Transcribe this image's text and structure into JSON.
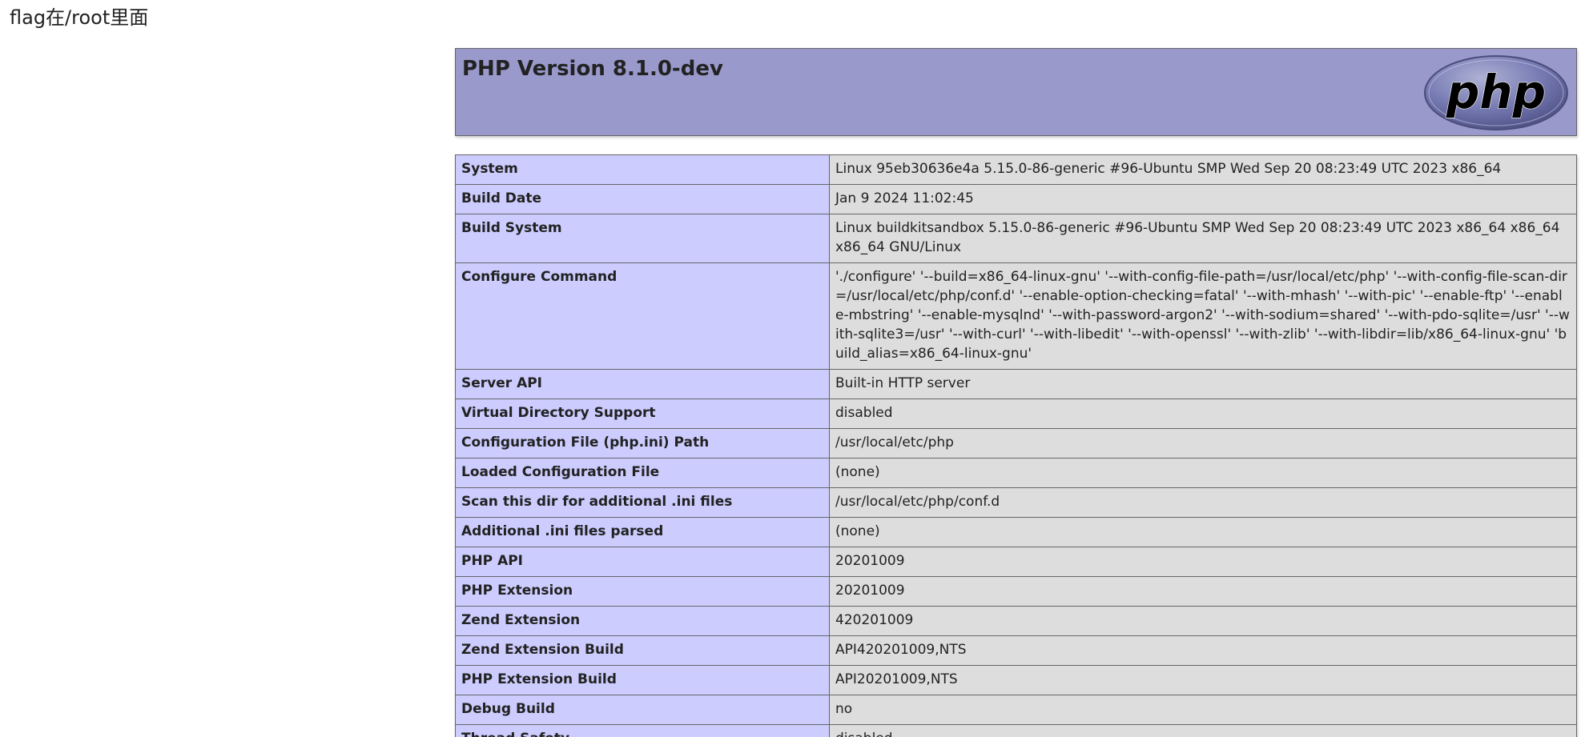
{
  "page": {
    "note": "flag在/root里面"
  },
  "header": {
    "title": "PHP Version 8.1.0-dev",
    "logo_text": "php"
  },
  "info_table": {
    "rows": [
      {
        "label": "System",
        "value": "Linux 95eb30636e4a 5.15.0-86-generic #96-Ubuntu SMP Wed Sep 20 08:23:49 UTC 2023 x86_64"
      },
      {
        "label": "Build Date",
        "value": "Jan 9 2024 11:02:45"
      },
      {
        "label": "Build System",
        "value": "Linux buildkitsandbox 5.15.0-86-generic #96-Ubuntu SMP Wed Sep 20 08:23:49 UTC 2023 x86_64 x86_64 x86_64 GNU/Linux"
      },
      {
        "label": "Configure Command",
        "value": "'./configure' '--build=x86_64-linux-gnu' '--with-config-file-path=/usr/local/etc/php' '--with-config-file-scan-dir=/usr/local/etc/php/conf.d' '--enable-option-checking=fatal' '--with-mhash' '--with-pic' '--enable-ftp' '--enable-mbstring' '--enable-mysqlnd' '--with-password-argon2' '--with-sodium=shared' '--with-pdo-sqlite=/usr' '--with-sqlite3=/usr' '--with-curl' '--with-libedit' '--with-openssl' '--with-zlib' '--with-libdir=lib/x86_64-linux-gnu' 'build_alias=x86_64-linux-gnu'"
      },
      {
        "label": "Server API",
        "value": "Built-in HTTP server"
      },
      {
        "label": "Virtual Directory Support",
        "value": "disabled"
      },
      {
        "label": "Configuration File (php.ini) Path",
        "value": "/usr/local/etc/php"
      },
      {
        "label": "Loaded Configuration File",
        "value": "(none)"
      },
      {
        "label": "Scan this dir for additional .ini files",
        "value": "/usr/local/etc/php/conf.d"
      },
      {
        "label": "Additional .ini files parsed",
        "value": "(none)"
      },
      {
        "label": "PHP API",
        "value": "20201009"
      },
      {
        "label": "PHP Extension",
        "value": "20201009"
      },
      {
        "label": "Zend Extension",
        "value": "420201009"
      },
      {
        "label": "Zend Extension Build",
        "value": "API420201009,NTS"
      },
      {
        "label": "PHP Extension Build",
        "value": "API20201009,NTS"
      },
      {
        "label": "Debug Build",
        "value": "no"
      },
      {
        "label": "Thread Safety",
        "value": "disabled"
      }
    ]
  },
  "colors": {
    "header_bg": "#9999cc",
    "label_bg": "#ccccff",
    "value_bg": "#dddddd",
    "border": "#666666"
  }
}
